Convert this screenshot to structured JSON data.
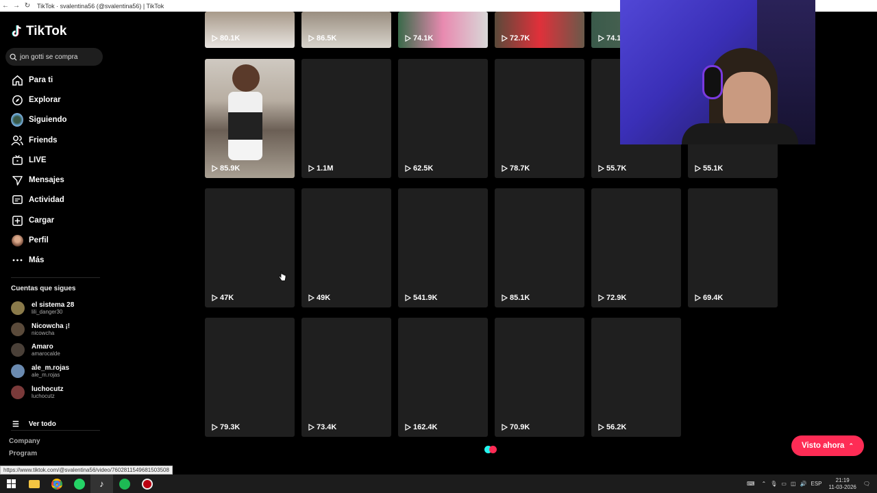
{
  "browser": {
    "title": "TikTok · svalentina56 (@svalentina56) | TikTok"
  },
  "sidebar": {
    "logo_text": "TikTok",
    "search_text": "jon gotti se compra",
    "nav": [
      {
        "label": "Para ti",
        "icon": "home-icon"
      },
      {
        "label": "Explorar",
        "icon": "compass-icon"
      },
      {
        "label": "Siguiendo",
        "icon": "following-avatar-icon"
      },
      {
        "label": "Friends",
        "icon": "friends-icon"
      },
      {
        "label": "LIVE",
        "icon": "live-icon"
      },
      {
        "label": "Mensajes",
        "icon": "messages-icon"
      },
      {
        "label": "Actividad",
        "icon": "activity-icon"
      },
      {
        "label": "Cargar",
        "icon": "upload-icon"
      },
      {
        "label": "Perfil",
        "icon": "profile-avatar-icon"
      },
      {
        "label": "Más",
        "icon": "more-icon"
      }
    ],
    "following_title": "Cuentas que sigues",
    "accounts": [
      {
        "name": "el sistema 28",
        "handle": "lili_danger30",
        "color": "#8a7a4a"
      },
      {
        "name": "Nicowcha ¡!",
        "handle": "nicowcha",
        "color": "#5a4a3a"
      },
      {
        "name": "Amaro",
        "handle": "amarocalde",
        "color": "#4a4038"
      },
      {
        "name": "ale_m.rojas",
        "handle": "ale_m.rojas",
        "color": "#6a8ab0"
      },
      {
        "name": "luchocutz",
        "handle": "luchocutz",
        "color": "#7a3a3a"
      }
    ],
    "see_all": "Ver todo",
    "footer": [
      "Company",
      "Program"
    ]
  },
  "status_url": "https://www.tiktok.com/@svalentina56/video/7602811549681503508",
  "grid": {
    "top_row": [
      "80.1K",
      "86.5K",
      "74.1K",
      "72.7K",
      "74.1"
    ],
    "rows": [
      [
        "85.9K",
        "1.1M",
        "62.5K",
        "78.7K",
        "55.7K",
        "55.1K"
      ],
      [
        "47K",
        "49K",
        "541.9K",
        "85.1K",
        "72.9K",
        "69.4K"
      ],
      [
        "79.3K",
        "73.4K",
        "162.4K",
        "70.9K",
        "56.2K"
      ]
    ]
  },
  "visto_button": "Visto ahora",
  "taskbar": {
    "lang": "ESP",
    "time": "21:19",
    "date": "11-03-2026"
  }
}
